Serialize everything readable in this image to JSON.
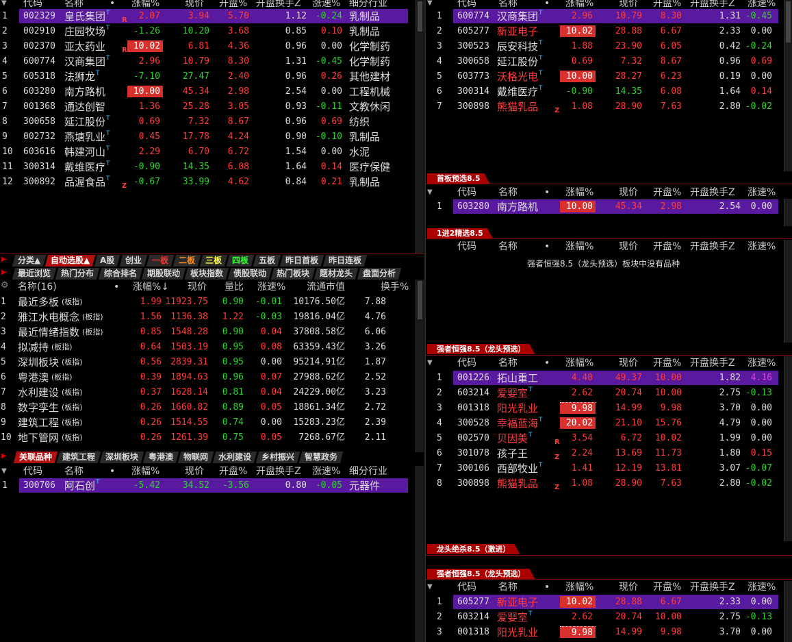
{
  "colors": {
    "up": "#ff3b3b",
    "down": "#2fd22f",
    "select": "#5a1aa0",
    "accent": "#d8302c"
  },
  "top_left": {
    "headers": [
      "代码",
      "名称",
      "•",
      "涨幅%",
      "现价",
      "开盘%",
      "开盘换手Z",
      "涨速%",
      "细分行业"
    ],
    "rows": [
      {
        "idx": "1",
        "code": "002329",
        "name": "皇氏集团",
        "t": "T",
        "tag": "R",
        "chg": "2.07",
        "price": "3.94",
        "open": "5.70",
        "turn": "1.12",
        "spd": "-0.24",
        "ind": "乳制品",
        "sel": true
      },
      {
        "idx": "2",
        "code": "002910",
        "name": "庄园牧场",
        "t": "T",
        "tag": "",
        "chg": "-1.26",
        "price": "10.20",
        "open": "3.68",
        "turn": "0.85",
        "spd": "0.10",
        "ind": "乳制品"
      },
      {
        "idx": "3",
        "code": "002370",
        "name": "亚太药业",
        "t": "",
        "tag": "R",
        "chg": "10.02",
        "price": "6.81",
        "open": "4.36",
        "turn": "0.96",
        "spd": "0.00",
        "ind": "化学制药",
        "box": true
      },
      {
        "idx": "4",
        "code": "600774",
        "name": "汉商集团",
        "t": "T",
        "tag": "",
        "chg": "2.96",
        "price": "10.79",
        "open": "8.30",
        "turn": "1.31",
        "spd": "-0.45",
        "ind": "化学制药"
      },
      {
        "idx": "5",
        "code": "605318",
        "name": "法狮龙",
        "t": "T",
        "tag": "",
        "chg": "-7.10",
        "price": "27.47",
        "open": "2.40",
        "turn": "0.96",
        "spd": "0.26",
        "ind": "其他建材"
      },
      {
        "idx": "6",
        "code": "603280",
        "name": "南方路机",
        "t": "",
        "tag": "",
        "chg": "10.00",
        "price": "45.34",
        "open": "2.98",
        "turn": "2.54",
        "spd": "0.00",
        "ind": "工程机械",
        "box": true
      },
      {
        "idx": "7",
        "code": "001368",
        "name": "通达创智",
        "t": "",
        "tag": "",
        "chg": "1.36",
        "price": "25.28",
        "open": "3.05",
        "turn": "0.93",
        "spd": "-0.11",
        "ind": "文教休闲"
      },
      {
        "idx": "8",
        "code": "300658",
        "name": "延江股份",
        "t": "T",
        "tag": "",
        "chg": "0.69",
        "price": "7.32",
        "open": "8.67",
        "turn": "0.96",
        "spd": "0.69",
        "ind": "纺织"
      },
      {
        "idx": "9",
        "code": "002732",
        "name": "燕塘乳业",
        "t": "T",
        "tag": "",
        "chg": "0.45",
        "price": "17.78",
        "open": "4.24",
        "turn": "0.90",
        "spd": "-0.10",
        "ind": "乳制品"
      },
      {
        "idx": "10",
        "code": "603616",
        "name": "韩建河山",
        "t": "T",
        "tag": "",
        "chg": "2.29",
        "price": "6.70",
        "open": "6.72",
        "turn": "1.54",
        "spd": "0.00",
        "ind": "水泥"
      },
      {
        "idx": "11",
        "code": "300314",
        "name": "戴维医疗",
        "t": "T",
        "tag": "",
        "chg": "-0.90",
        "price": "14.35",
        "open": "6.08",
        "turn": "1.64",
        "spd": "0.14",
        "ind": "医疗保健"
      },
      {
        "idx": "12",
        "code": "300892",
        "name": "品渥食品",
        "t": "T",
        "tag": "Z",
        "chg": "-0.67",
        "price": "33.99",
        "open": "4.62",
        "turn": "0.84",
        "spd": "0.21",
        "ind": "乳制品"
      }
    ]
  },
  "tabs1": [
    "分类▲",
    "自动选股▲",
    "A股",
    "创业",
    "一板",
    "二板",
    "三板",
    "四板",
    "五板",
    "昨日首板",
    "昨日连板"
  ],
  "tabs2": [
    "最近浏览",
    "热门分布",
    "综合排名",
    "期股联动",
    "板块指数",
    "债股联动",
    "热门板块",
    "题材龙头",
    "盘面分析"
  ],
  "sector": {
    "headers": [
      "名称(16)",
      "•",
      "涨幅%↓",
      "现价",
      "量比",
      "涨速%",
      "流通市值",
      "换手%"
    ],
    "rows": [
      {
        "idx": "1",
        "name": "最近多板",
        "sfx": "(板指)",
        "chg": "1.99",
        "price": "11923.75",
        "vr": "0.90",
        "spd": "-0.01",
        "cap": "10176.50亿",
        "turn": "7.88"
      },
      {
        "idx": "2",
        "name": "雅江水电概念",
        "sfx": "(板指)",
        "chg": "1.56",
        "price": "1136.38",
        "vr": "1.22",
        "spd": "-0.03",
        "cap": "19816.04亿",
        "turn": "4.76"
      },
      {
        "idx": "3",
        "name": "最近情绪指数",
        "sfx": "(板指)",
        "chg": "0.85",
        "price": "1548.28",
        "vr": "0.90",
        "spd": "0.04",
        "cap": "37808.58亿",
        "turn": "6.06"
      },
      {
        "idx": "4",
        "name": "拟减持",
        "sfx": "(板指)",
        "chg": "0.64",
        "price": "1503.19",
        "vr": "0.95",
        "spd": "0.08",
        "cap": "63359.43亿",
        "turn": "3.26"
      },
      {
        "idx": "5",
        "name": "深圳板块",
        "sfx": "(板指)",
        "chg": "0.56",
        "price": "2839.31",
        "vr": "0.95",
        "spd": "0.00",
        "cap": "95214.91亿",
        "turn": "1.87"
      },
      {
        "idx": "6",
        "name": "粤港澳",
        "sfx": "(板指)",
        "chg": "0.39",
        "price": "1894.63",
        "vr": "0.96",
        "spd": "0.07",
        "cap": "27988.62亿",
        "turn": "2.52"
      },
      {
        "idx": "7",
        "name": "水利建设",
        "sfx": "(板指)",
        "chg": "0.37",
        "price": "1628.14",
        "vr": "0.81",
        "spd": "0.04",
        "cap": "24229.00亿",
        "turn": "3.23"
      },
      {
        "idx": "8",
        "name": "数字孪生",
        "sfx": "(板指)",
        "chg": "0.26",
        "price": "1660.82",
        "vr": "0.89",
        "spd": "0.05",
        "cap": "18861.34亿",
        "turn": "2.72"
      },
      {
        "idx": "9",
        "name": "建筑工程",
        "sfx": "(板指)",
        "chg": "0.26",
        "price": "1514.55",
        "vr": "0.74",
        "spd": "0.00",
        "cap": "15283.23亿",
        "turn": "2.39"
      },
      {
        "idx": "10",
        "name": "地下管网",
        "sfx": "(板指)",
        "chg": "0.26",
        "price": "1261.39",
        "vr": "0.75",
        "spd": "0.05",
        "cap": "7268.67亿",
        "turn": "2.11"
      }
    ]
  },
  "tabs3": [
    "关联品种",
    "建筑工程",
    "深圳板块",
    "粤港澳",
    "物联网",
    "水利建设",
    "乡村振兴",
    "智慧政务"
  ],
  "assoc": {
    "headers": [
      "代码",
      "名称",
      "•",
      "涨幅%",
      "现价",
      "开盘%",
      "开盘换手Z",
      "涨速%",
      "细分行业"
    ],
    "rows": [
      {
        "idx": "1",
        "code": "300706",
        "name": "阿石创",
        "t": "T",
        "chg": "-5.42",
        "price": "34.52",
        "open": "-3.56",
        "turn": "0.80",
        "spd": "-0.05",
        "ind": "元器件",
        "sel": true
      }
    ]
  },
  "right_headers": [
    "代码",
    "名称",
    "•",
    "涨幅%",
    "现价",
    "开盘%",
    "开盘换手Z",
    "涨速%"
  ],
  "r1": {
    "rows": [
      {
        "idx": "1",
        "code": "600774",
        "name": "汉商集团",
        "t": "T",
        "tag": "",
        "chg": "2.96",
        "price": "10.79",
        "open": "8.30",
        "turn": "1.31",
        "spd": "-0.45",
        "sel": true
      },
      {
        "idx": "2",
        "code": "605277",
        "name": "新亚电子",
        "t": "",
        "tag": "",
        "chg": "10.02",
        "price": "28.88",
        "open": "6.67",
        "turn": "2.33",
        "spd": "0.00",
        "box": true,
        "rn": true
      },
      {
        "idx": "3",
        "code": "300523",
        "name": "辰安科技",
        "t": "T",
        "tag": "",
        "chg": "1.88",
        "price": "23.90",
        "open": "6.05",
        "turn": "0.42",
        "spd": "-0.24"
      },
      {
        "idx": "4",
        "code": "300658",
        "name": "延江股份",
        "t": "T",
        "tag": "",
        "chg": "0.69",
        "price": "7.32",
        "open": "8.67",
        "turn": "0.96",
        "spd": "0.69"
      },
      {
        "idx": "5",
        "code": "603773",
        "name": "沃格光电",
        "t": "T",
        "tag": "",
        "chg": "10.00",
        "price": "28.27",
        "open": "6.23",
        "turn": "0.19",
        "spd": "0.00",
        "box": true,
        "rn": true
      },
      {
        "idx": "6",
        "code": "300314",
        "name": "戴维医疗",
        "t": "T",
        "tag": "",
        "chg": "-0.90",
        "price": "14.35",
        "open": "6.08",
        "turn": "1.64",
        "spd": "0.14"
      },
      {
        "idx": "7",
        "code": "300898",
        "name": "熊猫乳品",
        "t": "",
        "tag": "Z",
        "chg": "1.08",
        "price": "28.90",
        "open": "7.63",
        "turn": "2.80",
        "spd": "-0.02",
        "rn": true
      }
    ]
  },
  "p2": {
    "title": "首板预选8.5",
    "rows": [
      {
        "idx": "1",
        "code": "603280",
        "name": "南方路机",
        "t": "",
        "tag": "",
        "chg": "10.00",
        "price": "45.34",
        "open": "2.98",
        "turn": "2.54",
        "spd": "0.00",
        "box": true,
        "sel": true
      }
    ]
  },
  "p3": {
    "title": "1进2精选8.5",
    "empty": "强者恒强8.5（龙头预选）板块中没有品种"
  },
  "p4": {
    "title": "强者恒强8.5（龙头预选）",
    "rows": [
      {
        "idx": "1",
        "code": "001226",
        "name": "拓山重工",
        "t": "",
        "tag": "",
        "chg": "4.40",
        "price": "49.37",
        "open": "10.00",
        "turn": "1.82",
        "spd": "4.16",
        "sel": true,
        "spdmag": true
      },
      {
        "idx": "2",
        "code": "603214",
        "name": "爱婴室",
        "t": "T",
        "tag": "",
        "chg": "2.62",
        "price": "20.74",
        "open": "10.00",
        "turn": "2.75",
        "spd": "-0.13",
        "rn": true
      },
      {
        "idx": "3",
        "code": "001318",
        "name": "阳光乳业",
        "t": "",
        "tag": "",
        "chg": "9.98",
        "price": "14.99",
        "open": "9.98",
        "turn": "3.70",
        "spd": "0.00",
        "dot": true,
        "rn": true
      },
      {
        "idx": "4",
        "code": "300528",
        "name": "幸福蓝海",
        "t": "T",
        "tag": "",
        "chg": "20.02",
        "price": "21.10",
        "open": "15.76",
        "turn": "4.79",
        "spd": "0.00",
        "box": true,
        "rn": true
      },
      {
        "idx": "5",
        "code": "002570",
        "name": "贝因美",
        "t": "T",
        "tag": "R",
        "chg": "3.54",
        "price": "6.72",
        "open": "10.02",
        "turn": "1.99",
        "spd": "0.00",
        "rn": true
      },
      {
        "idx": "6",
        "code": "301078",
        "name": "孩子王",
        "t": "",
        "tag": "Z",
        "chg": "2.24",
        "price": "13.69",
        "open": "11.73",
        "turn": "1.80",
        "spd": "0.15"
      },
      {
        "idx": "7",
        "code": "300106",
        "name": "西部牧业",
        "t": "T",
        "tag": "",
        "chg": "1.41",
        "price": "12.19",
        "open": "13.81",
        "turn": "3.07",
        "spd": "-0.07"
      },
      {
        "idx": "8",
        "code": "300898",
        "name": "熊猫乳品",
        "t": "",
        "tag": "Z",
        "chg": "1.08",
        "price": "28.90",
        "open": "7.63",
        "turn": "2.80",
        "spd": "-0.02",
        "rn": true
      }
    ]
  },
  "p5": {
    "title": "龙头绝杀8.5（激进）"
  },
  "p6": {
    "title": "强者恒强8.5（龙头预选）",
    "rows": [
      {
        "idx": "1",
        "code": "605277",
        "name": "新亚电子",
        "t": "",
        "tag": "",
        "chg": "10.02",
        "price": "28.88",
        "open": "6.67",
        "turn": "2.33",
        "spd": "0.00",
        "box": true,
        "sel": true,
        "rn": true
      },
      {
        "idx": "2",
        "code": "603214",
        "name": "爱婴室",
        "t": "T",
        "tag": "",
        "chg": "2.62",
        "price": "20.74",
        "open": "10.00",
        "turn": "2.75",
        "spd": "-0.13",
        "rn": true
      },
      {
        "idx": "3",
        "code": "001318",
        "name": "阳光乳业",
        "t": "",
        "tag": "",
        "chg": "9.98",
        "price": "14.99",
        "open": "9.98",
        "turn": "3.70",
        "spd": "0.00",
        "dot": true,
        "rn": true
      }
    ]
  }
}
